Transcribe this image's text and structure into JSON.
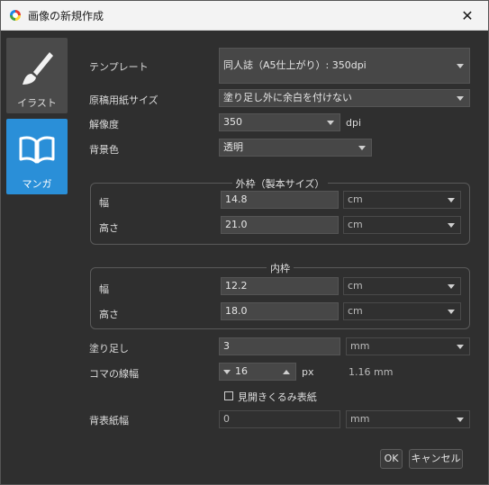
{
  "window": {
    "title": "画像の新規作成",
    "close_icon": "close-icon"
  },
  "sidebar": {
    "items": [
      {
        "label": "イラスト",
        "icon": "brush-icon"
      },
      {
        "label": "マンガ",
        "icon": "book-icon"
      }
    ],
    "selected": "マンガ",
    "selected_color": "#2a8fd8"
  },
  "form": {
    "template": {
      "label": "テンプレート",
      "value": "同人誌（A5仕上がり）: 350dpi"
    },
    "paper_size": {
      "label": "原稿用紙サイズ",
      "value": "塗り足し外に余白を付けない"
    },
    "resolution": {
      "label": "解像度",
      "value": "350",
      "unit": "dpi"
    },
    "background": {
      "label": "背景色",
      "value": "透明"
    }
  },
  "outer_frame": {
    "title": "外枠（製本サイズ）",
    "width": {
      "label": "幅",
      "value": "14.8",
      "unit": "cm"
    },
    "height": {
      "label": "高さ",
      "value": "21.0",
      "unit": "cm"
    }
  },
  "inner_frame": {
    "title": "内枠",
    "width": {
      "label": "幅",
      "value": "12.2",
      "unit": "cm"
    },
    "height": {
      "label": "高さ",
      "value": "18.0",
      "unit": "cm"
    }
  },
  "bleed": {
    "label": "塗り足し",
    "value": "3",
    "unit": "mm"
  },
  "panel_line": {
    "label": "コマの線幅",
    "value": "16",
    "unit": "px",
    "converted": "1.16 mm"
  },
  "spread": {
    "label": "見開きくるみ表紙",
    "checked": false
  },
  "spine": {
    "label": "背表紙幅",
    "value": "0",
    "unit": "mm"
  },
  "buttons": {
    "ok": "OK",
    "cancel": "キャンセル"
  }
}
